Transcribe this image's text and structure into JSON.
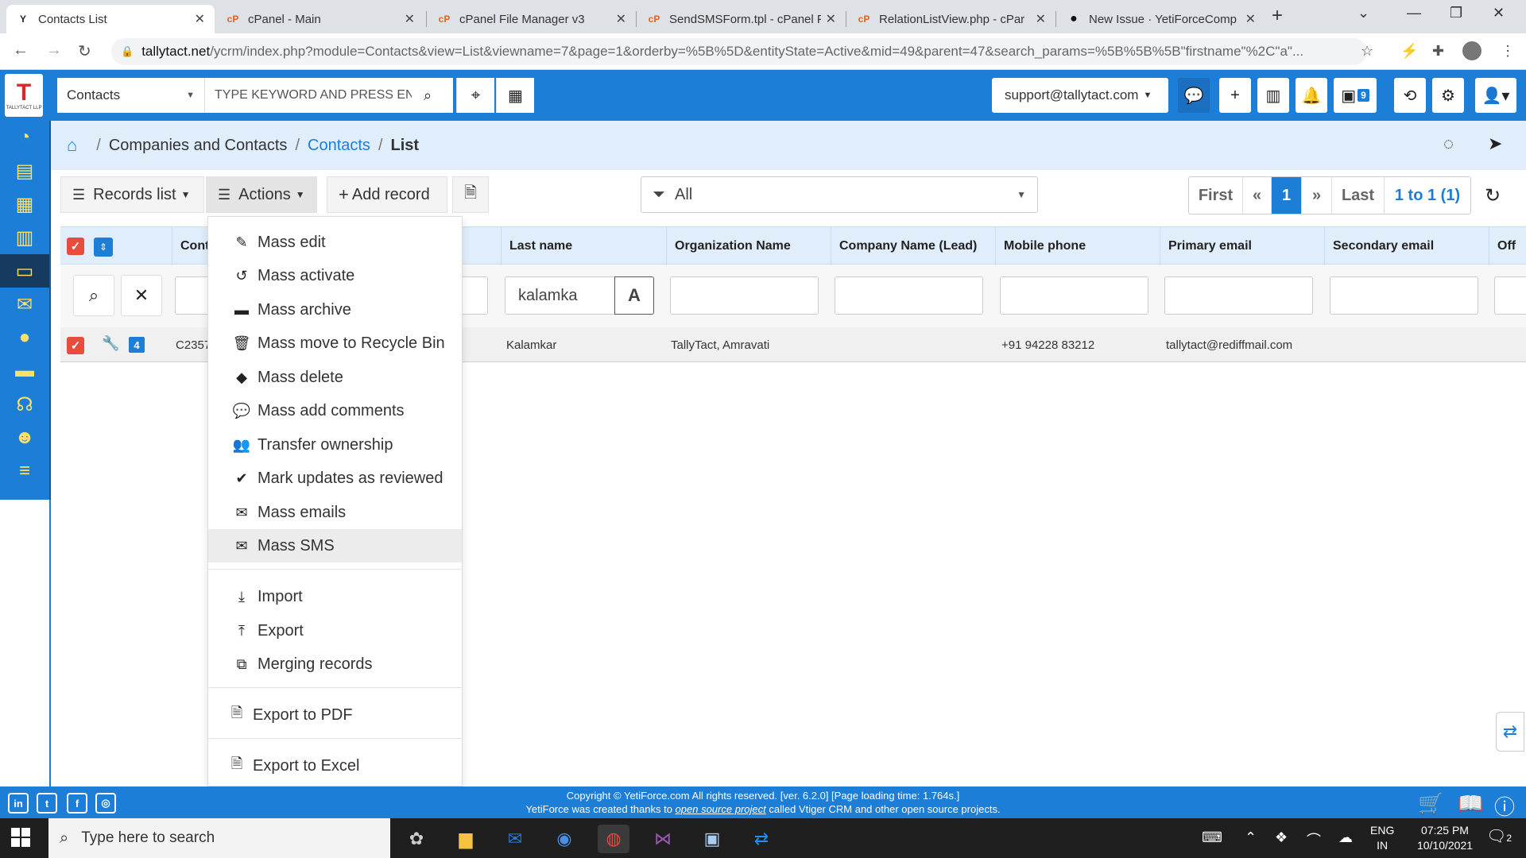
{
  "browser": {
    "tabs": [
      {
        "title": "Contacts List",
        "favicon": "yetiforce-icon"
      },
      {
        "title": "cPanel - Main",
        "favicon": "cpanel-icon"
      },
      {
        "title": "cPanel File Manager v3",
        "favicon": "cpanel-icon"
      },
      {
        "title": "SendSMSForm.tpl - cPanel F",
        "favicon": "cpanel-icon"
      },
      {
        "title": "RelationListView.php - cPar",
        "favicon": "cpanel-icon"
      },
      {
        "title": "New Issue · YetiForceComp",
        "favicon": "github-icon"
      }
    ],
    "url_host": "tallytact.net",
    "url_rest": "/ycrm/index.php?module=Contacts&view=List&viewname=7&page=1&orderby=%5B%5D&entityState=Active&mid=49&parent=47&search_params=%5B%5B%5B\"firstname\"%2C\"a\"..."
  },
  "header": {
    "logo_text": "T",
    "logo_subtext": "TALLYTACT LLP",
    "module": "Contacts",
    "search_placeholder": "TYPE KEYWORD AND PRESS EN",
    "user": "support@tallytact.com",
    "calendar_count": "9"
  },
  "breadcrumb": {
    "items": [
      "Companies and Contacts",
      "Contacts",
      "List"
    ]
  },
  "toolbar": {
    "records_list": "Records list",
    "actions": "Actions",
    "add_record": "Add record",
    "filter_value": "All"
  },
  "pagination": {
    "first": "First",
    "prev": "«",
    "current": "1",
    "next": "»",
    "last": "Last",
    "count": "1 to 1 (1)"
  },
  "table": {
    "columns": [
      "Cont",
      "Last name",
      "Organization Name",
      "Company Name (Lead)",
      "Mobile phone",
      "Primary email",
      "Secondary email",
      "Off"
    ],
    "filter_values": {
      "last_name": "kalamka"
    },
    "filter_toggle": "A",
    "row": {
      "badge": "4",
      "contact_no": "C2357",
      "last_name": "Kalamkar",
      "organization": "TallyTact, Amravati",
      "mobile": "+91 94228 83212",
      "email": "tallytact@rediffmail.com"
    }
  },
  "actions_menu": {
    "items": [
      {
        "label": "Mass edit",
        "icon": "pencil-icon"
      },
      {
        "label": "Mass activate",
        "icon": "undo-icon"
      },
      {
        "label": "Mass archive",
        "icon": "archive-icon"
      },
      {
        "label": "Mass move to Recycle Bin",
        "icon": "trash-icon"
      },
      {
        "label": "Mass delete",
        "icon": "eraser-icon"
      },
      {
        "label": "Mass add comments",
        "icon": "comments-icon"
      },
      {
        "label": "Transfer ownership",
        "icon": "users-icon"
      },
      {
        "label": "Mark updates as reviewed",
        "icon": "check-circle-icon"
      },
      {
        "label": "Mass emails",
        "icon": "envelope-icon"
      },
      {
        "label": "Mass SMS",
        "icon": "envelope-icon"
      },
      {
        "label": "Import",
        "icon": "download-icon"
      },
      {
        "label": "Export",
        "icon": "upload-icon"
      },
      {
        "label": "Merging records",
        "icon": "merge-icon"
      },
      {
        "label": "Export to PDF",
        "icon": "pdf-file-icon"
      },
      {
        "label": "Export to Excel",
        "icon": "excel-file-icon"
      }
    ],
    "hovered": "Mass SMS"
  },
  "footer": {
    "line1": "Copyright © YetiForce.com All rights reserved. [ver. 6.2.0] [Page loading time: 1.764s.]",
    "line2_pre": "YetiForce was created thanks to ",
    "line2_link": "open source project",
    "line2_post": " called Vtiger CRM and other open source projects."
  },
  "taskbar": {
    "search_placeholder": "Type here to search",
    "lang_top": "ENG",
    "lang_bottom": "IN",
    "time": "07:25 PM",
    "date": "10/10/2021",
    "notifications": "2"
  },
  "colors": {
    "brand_blue": "#1d7ed8",
    "header_light": "#e0eefb",
    "checkbox_red": "#e74c3c",
    "sidebar_icon_yellow": "#ffe066"
  }
}
